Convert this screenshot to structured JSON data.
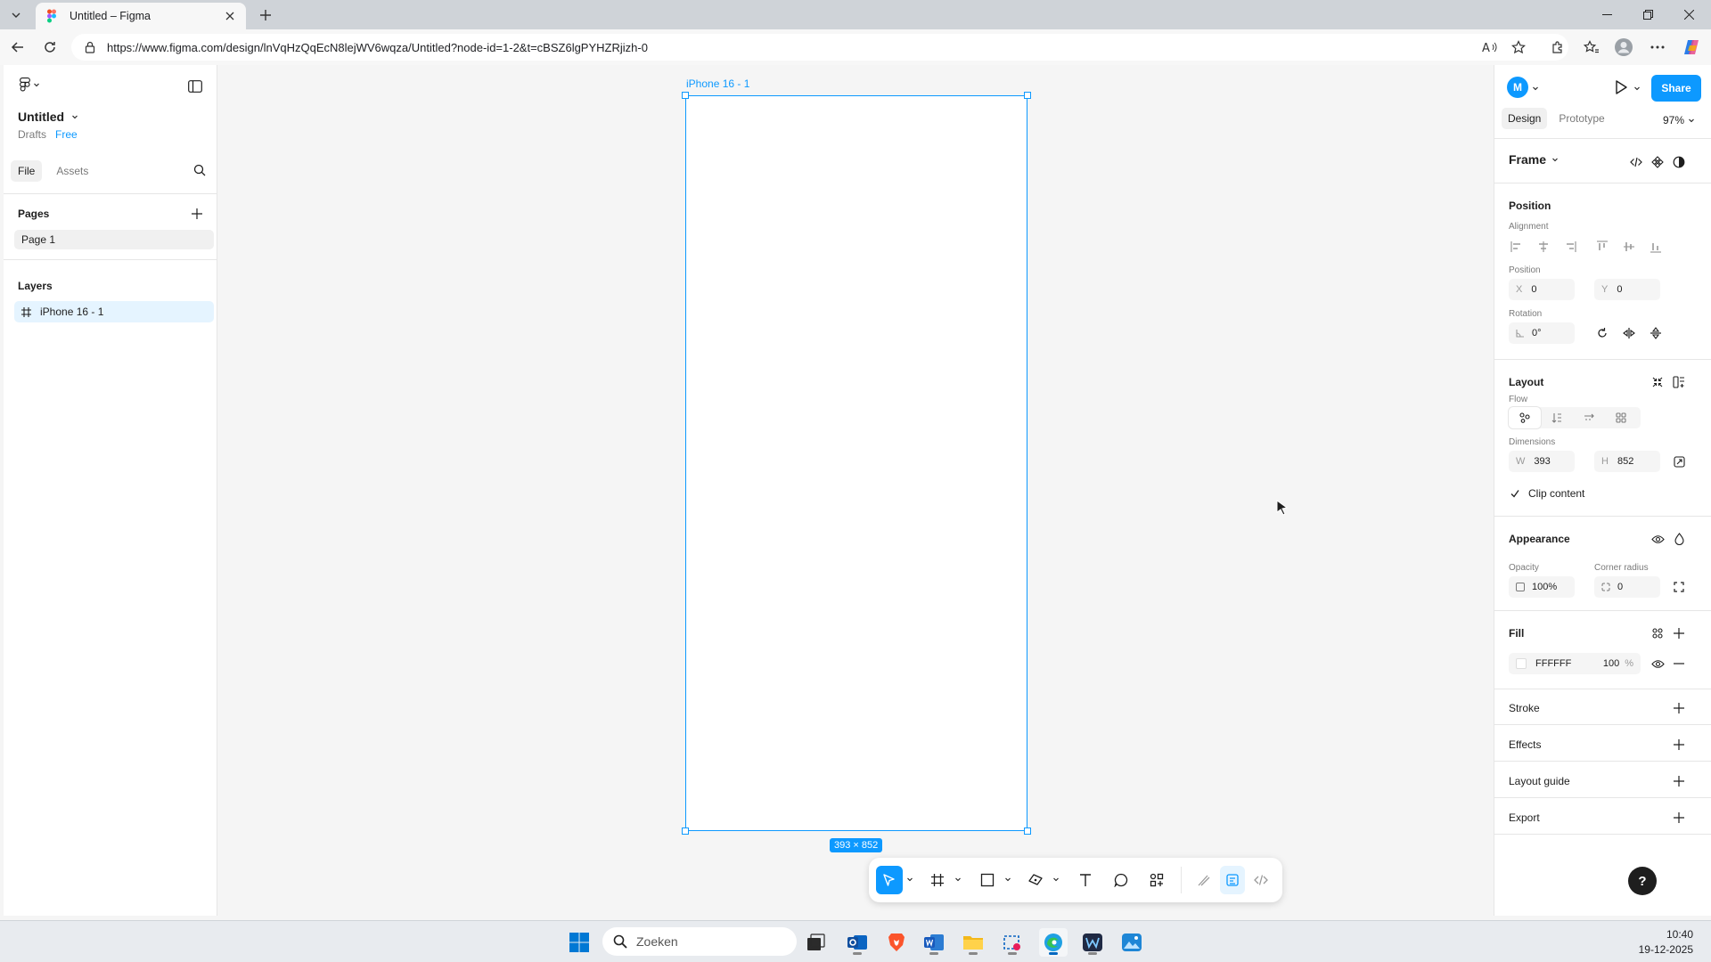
{
  "browser": {
    "tab_title": "Untitled – Figma",
    "url": "https://www.figma.com/design/lnVqHzQqEcN8lejWV6wqza/Untitled?node-id=1-2&t=cBSZ6lgPYHZRjizh-0"
  },
  "left_panel": {
    "file_name": "Untitled",
    "location": "Drafts",
    "plan": "Free",
    "tabs": [
      "File",
      "Assets"
    ],
    "pages_title": "Pages",
    "pages": [
      "Page 1"
    ],
    "layers_title": "Layers",
    "layers": [
      "iPhone 16 - 1"
    ]
  },
  "canvas": {
    "frame_label": "iPhone 16 - 1",
    "dimensions_badge": "393 × 852"
  },
  "right_panel": {
    "avatar_initial": "M",
    "share_label": "Share",
    "tabs": [
      "Design",
      "Prototype"
    ],
    "zoom": "97%",
    "selection_type": "Frame",
    "position": {
      "title": "Position",
      "alignment_label": "Alignment",
      "position_label": "Position",
      "x_label": "X",
      "x": "0",
      "y_label": "Y",
      "y": "0",
      "rotation_label": "Rotation",
      "rotation": "0°"
    },
    "layout": {
      "title": "Layout",
      "flow_label": "Flow",
      "dimensions_label": "Dimensions",
      "w_label": "W",
      "w": "393",
      "h_label": "H",
      "h": "852",
      "clip_content": "Clip content"
    },
    "appearance": {
      "title": "Appearance",
      "opacity_label": "Opacity",
      "opacity": "100%",
      "radius_label": "Corner radius",
      "radius": "0"
    },
    "fill": {
      "title": "Fill",
      "color": "FFFFFF",
      "opacity": "100",
      "unit": "%"
    },
    "sections": [
      "Stroke",
      "Effects",
      "Layout guide",
      "Export"
    ],
    "help": "?"
  },
  "taskbar": {
    "search_placeholder": "Zoeken",
    "time": "10:40",
    "date": "19-12-2025"
  },
  "colors": {
    "accent": "#0d99ff",
    "selection_bg": "#e5f4ff"
  }
}
